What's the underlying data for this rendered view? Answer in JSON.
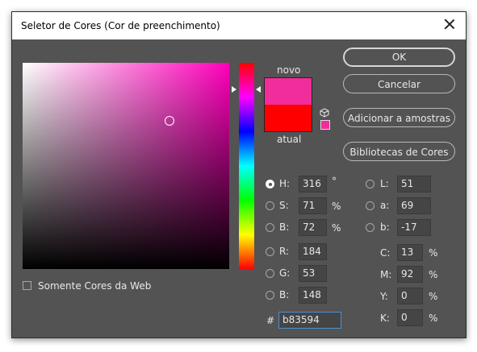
{
  "window": {
    "title": "Seletor de Cores (Cor de preenchimento)"
  },
  "swatches": {
    "new_label": "novo",
    "current_label": "atual",
    "new_color": "#f02d9a",
    "current_color": "#ff0000"
  },
  "buttons": {
    "ok": "OK",
    "cancel": "Cancelar",
    "add_to_swatches": "Adicionar a amostras",
    "color_libraries": "Bibliotecas de Cores"
  },
  "web_only": {
    "label": "Somente Cores da Web",
    "checked": false
  },
  "hsb": {
    "h": {
      "label": "H:",
      "value": "316",
      "unit": "°",
      "selected": true
    },
    "s": {
      "label": "S:",
      "value": "71",
      "unit": "%"
    },
    "b": {
      "label": "B:",
      "value": "72",
      "unit": "%"
    }
  },
  "rgb": {
    "r": {
      "label": "R:",
      "value": "184"
    },
    "g": {
      "label": "G:",
      "value": "53"
    },
    "b": {
      "label": "B:",
      "value": "148"
    }
  },
  "lab": {
    "l": {
      "label": "L:",
      "value": "51"
    },
    "a": {
      "label": "a:",
      "value": "69"
    },
    "b": {
      "label": "b:",
      "value": "-17"
    }
  },
  "cmyk": {
    "c": {
      "label": "C:",
      "value": "13",
      "unit": "%"
    },
    "m": {
      "label": "M:",
      "value": "92",
      "unit": "%"
    },
    "y": {
      "label": "Y:",
      "value": "0",
      "unit": "%"
    },
    "k": {
      "label": "K:",
      "value": "0",
      "unit": "%"
    }
  },
  "hex": {
    "label": "#",
    "value": "b83594"
  }
}
